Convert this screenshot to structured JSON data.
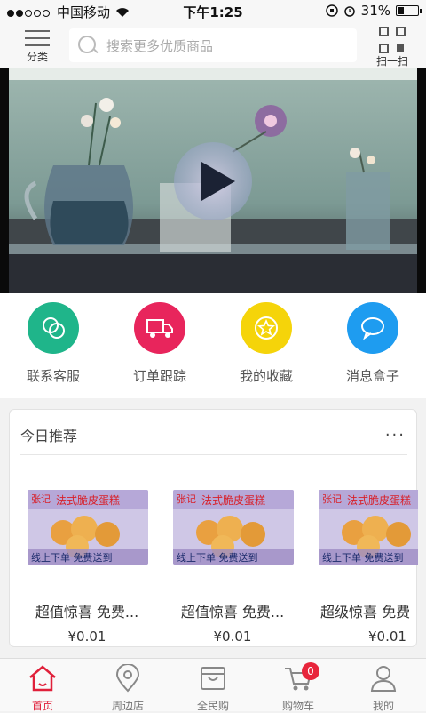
{
  "status_bar": {
    "carrier": "中国移动",
    "time": "下午1:25",
    "battery": "31%",
    "battery_level": 0.31
  },
  "header": {
    "category_label": "分类",
    "search_placeholder": "搜索更多优质商品",
    "scan_label": "扫一扫"
  },
  "quick_actions": [
    {
      "label": "联系客服",
      "icon": "chat-bubbles-icon",
      "color": "#1fb58a"
    },
    {
      "label": "订单跟踪",
      "icon": "truck-icon",
      "color": "#e8255c"
    },
    {
      "label": "我的收藏",
      "icon": "star-icon",
      "color": "#f5d40a"
    },
    {
      "label": "消息盒子",
      "icon": "message-icon",
      "color": "#1e9cf0"
    }
  ],
  "recommend": {
    "title": "今日推荐",
    "more": "···",
    "products": [
      {
        "name": "超值惊喜 免费...",
        "price": "¥0.01",
        "banner_top": "法式脆皮蛋糕",
        "banner_side": "张记",
        "banner_bottom": "线上下单 免费送到"
      },
      {
        "name": "超值惊喜 免费...",
        "price": "¥0.01",
        "banner_top": "法式脆皮蛋糕",
        "banner_side": "张记",
        "banner_bottom": "线上下单 免费送到"
      },
      {
        "name": "超级惊喜 免费",
        "price": "¥0.01",
        "banner_top": "法式脆皮蛋糕",
        "banner_side": "张记",
        "banner_bottom": "线上下单 免费送到"
      }
    ]
  },
  "tabbar": [
    {
      "label": "首页",
      "icon": "home-icon",
      "active": true
    },
    {
      "label": "周边店",
      "icon": "location-icon"
    },
    {
      "label": "全民购",
      "icon": "bag-icon"
    },
    {
      "label": "购物车",
      "icon": "cart-icon",
      "badge": "0"
    },
    {
      "label": "我的",
      "icon": "user-icon"
    }
  ],
  "colors": {
    "accent": "#e0203a",
    "background": "#f2f2f2"
  }
}
